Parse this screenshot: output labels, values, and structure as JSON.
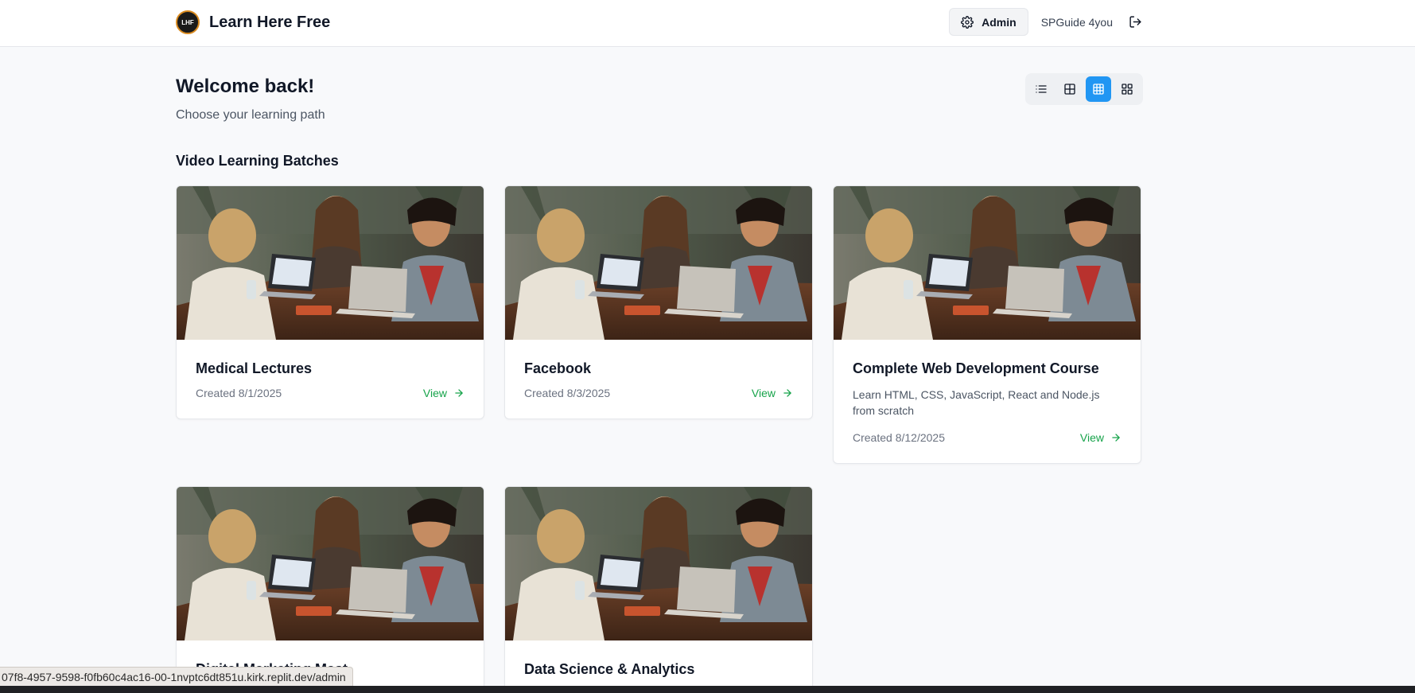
{
  "header": {
    "brand_title": "Learn Here Free",
    "logo_text": "LHF",
    "admin_label": "Admin",
    "user_name": "SPGuide 4you"
  },
  "main": {
    "welcome": "Welcome back!",
    "subtitle": "Choose your learning path",
    "section_title": "Video Learning Batches",
    "view_modes": [
      "list-view",
      "grid-2-view",
      "grid-3-view",
      "grid-4-view"
    ],
    "active_view": "grid-3-view",
    "accent_color": "#2196f3",
    "link_color": "#16a34a"
  },
  "cards": [
    {
      "title": "Medical Lectures",
      "description": "",
      "date": "Created 8/1/2025",
      "link": "View"
    },
    {
      "title": "Facebook",
      "description": "",
      "date": "Created 8/3/2025",
      "link": "View"
    },
    {
      "title": "Complete Web Development Course",
      "description": "Learn HTML, CSS, JavaScript, React and Node.js from scratch",
      "date": "Created 8/12/2025",
      "link": "View"
    },
    {
      "title": "Digital Marketing Mast",
      "description": "",
      "date": "",
      "link": ""
    },
    {
      "title": "Data Science & Analytics",
      "description": "",
      "date": "",
      "link": ""
    }
  ],
  "status_bar": {
    "url": "07f8-4957-9598-f0fb60c4ac16-00-1nvptc6dt851u.kirk.replit.dev/admin"
  }
}
